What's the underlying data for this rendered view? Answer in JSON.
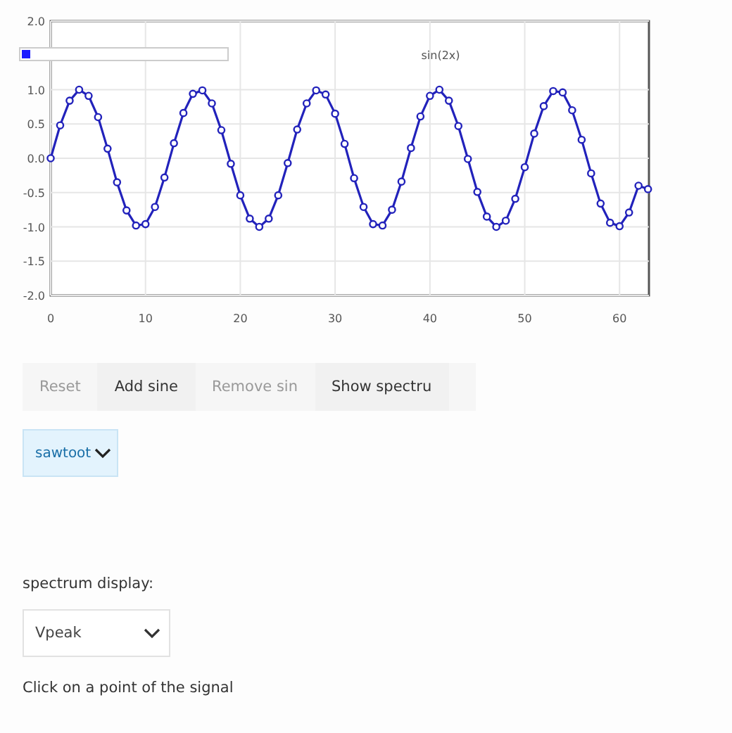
{
  "chart": {
    "chart_data": {
      "type": "line",
      "title": "sin(2x)",
      "x": [
        0,
        1,
        2,
        3,
        4,
        5,
        6,
        7,
        8,
        9,
        10,
        11,
        12,
        13,
        14,
        15,
        16,
        17,
        18,
        19,
        20,
        21,
        22,
        23,
        24,
        25,
        26,
        27,
        28,
        29,
        30,
        31,
        32,
        33,
        34,
        35,
        36,
        37,
        38,
        39,
        40,
        41,
        42,
        43,
        44,
        45,
        46,
        47,
        48,
        49,
        50,
        51,
        52,
        53,
        54,
        55,
        56,
        57,
        58,
        59,
        60,
        61,
        62,
        63
      ],
      "series": [
        {
          "color": "#2222bb",
          "marker": "circle",
          "values": [
            0,
            0.48,
            0.84,
            1.0,
            0.91,
            0.6,
            0.14,
            -0.35,
            -0.76,
            -0.98,
            -0.96,
            -0.71,
            -0.28,
            0.22,
            0.66,
            0.94,
            0.99,
            0.8,
            0.41,
            -0.08,
            -0.54,
            -0.88,
            -1.0,
            -0.88,
            -0.54,
            -0.07,
            0.42,
            0.8,
            0.99,
            0.93,
            0.65,
            0.21,
            -0.29,
            -0.71,
            -0.96,
            -0.98,
            -0.75,
            -0.34,
            0.15,
            0.61,
            0.91,
            1.0,
            0.84,
            0.47,
            -0.01,
            -0.49,
            -0.85,
            -1.0,
            -0.91,
            -0.59,
            -0.13,
            0.36,
            0.76,
            0.98,
            0.96,
            0.7,
            0.27,
            -0.22,
            -0.66,
            -0.94,
            -0.99,
            -0.79,
            -0.4,
            -0.45
          ]
        }
      ],
      "xlim": [
        0,
        63.1
      ],
      "ylim": [
        -2,
        2
      ],
      "xticks": [
        0,
        10,
        20,
        30,
        40,
        50,
        60
      ],
      "yticks": [
        {
          "value": -2,
          "label": "-2.0"
        },
        -1.5,
        {
          "value": -1,
          "label": "-1.0"
        },
        -0.5,
        {
          "value": 0,
          "label": "0.0"
        },
        0.5,
        {
          "value": 1,
          "label": "1.0"
        },
        {
          "value": 2,
          "label": "2.0"
        }
      ],
      "grid": true
    }
  },
  "buttons": [
    {
      "label": "Reset",
      "disabled": true
    },
    {
      "label": "Add sine",
      "disabled": false
    },
    {
      "label": "Remove sin",
      "disabled": true
    },
    {
      "label": "Show spectru",
      "disabled": false
    }
  ],
  "waveform_select": {
    "value": "sawtoot"
  },
  "spectrum": {
    "label": "spectrum display:",
    "value": "Vpeak"
  },
  "hint": "Click on a point of the signal"
}
